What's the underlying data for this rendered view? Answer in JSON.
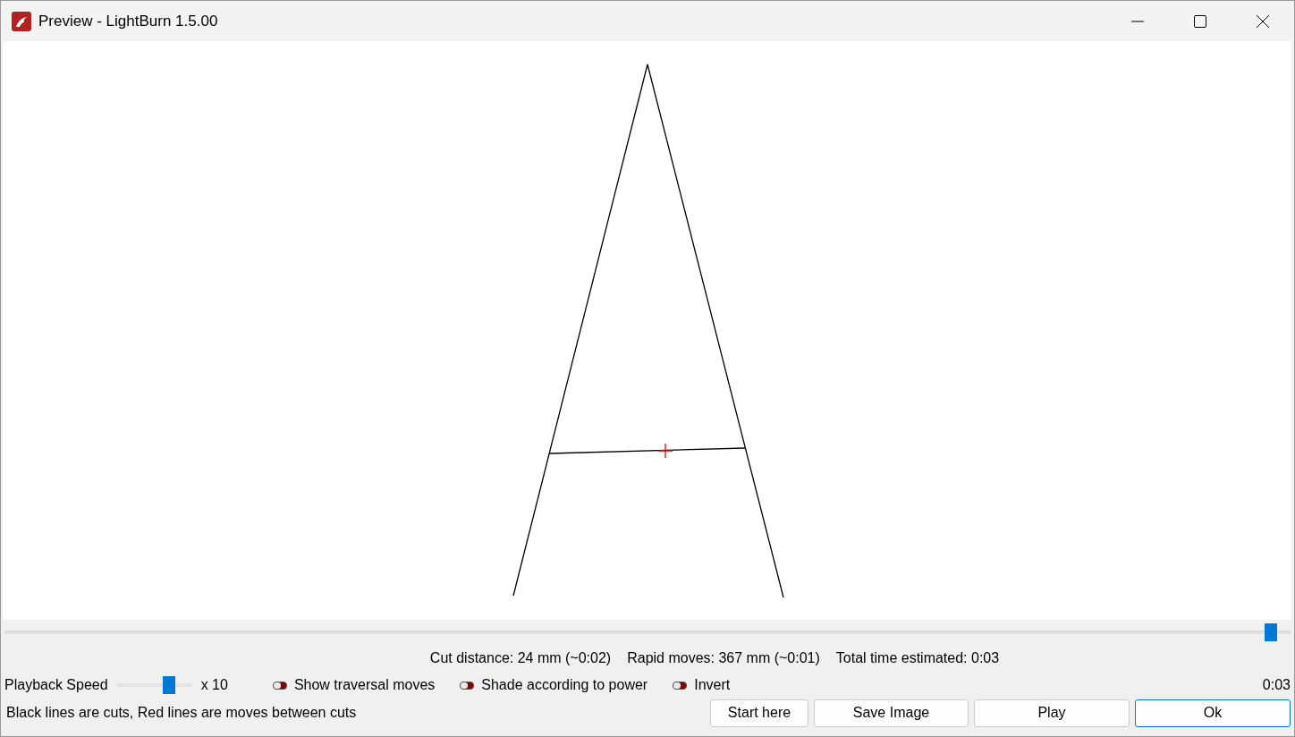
{
  "window": {
    "title": "Preview - LightBurn 1.5.00"
  },
  "timeline": {
    "level": 0.985
  },
  "stats": [
    "Cut distance: 24 mm (~0:02)",
    "Rapid moves: 367 mm (~0:01)",
    "Total time estimated: 0:03"
  ],
  "playback_speed": {
    "label": "Playback Speed",
    "level": 0.7,
    "reading": "x 10"
  },
  "options": [
    {
      "label": "Show traversal moves",
      "on": false
    },
    {
      "label": "Shade according to power",
      "on": false
    },
    {
      "label": "Invert",
      "on": false
    }
  ],
  "elapsed": "0:03",
  "legend": "Black lines are cuts, Red lines are moves between cuts",
  "buttons": [
    {
      "label": "Start here",
      "default": false
    },
    {
      "label": "Save Image",
      "default": false
    },
    {
      "label": "Play",
      "default": false
    },
    {
      "label": "Ok",
      "default": true
    }
  ]
}
